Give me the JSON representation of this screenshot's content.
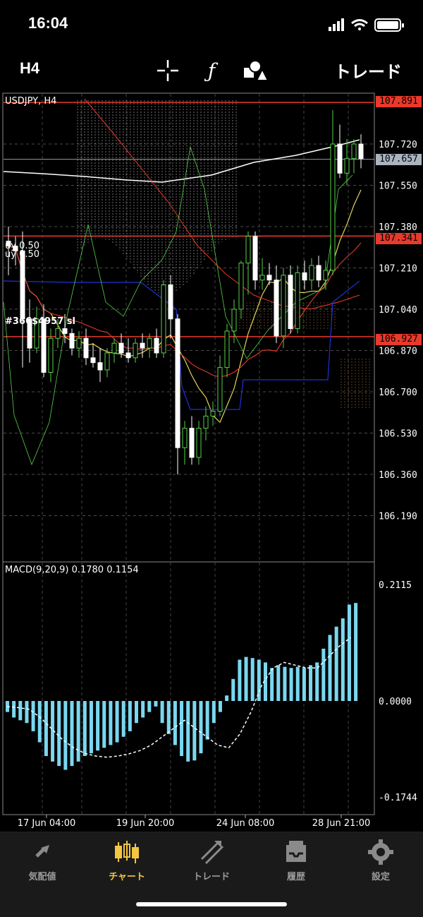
{
  "status": {
    "time": "16:04"
  },
  "toolbar": {
    "timeframe": "H4",
    "trade_label": "トレード",
    "icons": [
      "crosshair-icon",
      "function-icon",
      "objects-icon"
    ]
  },
  "chart": {
    "symbol_label": "USDJPY, H4",
    "price_ticks": [
      "107.720",
      "107.550",
      "107.380",
      "107.210",
      "107.040",
      "106.870",
      "106.700",
      "106.530",
      "106.360",
      "106.190"
    ],
    "badges": [
      {
        "text": "107.891",
        "color": "#e8392b"
      },
      {
        "text": "107.657",
        "color": "#aab4c0"
      },
      {
        "text": "107.341",
        "color": "#e8392b"
      },
      {
        "text": "106.927",
        "color": "#e8392b"
      }
    ],
    "order_labels": [
      "uy 0.50",
      "uy 0.50"
    ],
    "ticket_label": "#366$4957 sl",
    "time_labels": [
      "17 Jun 04:00",
      "19 Jun 20:00",
      "24 Jun 08:00",
      "28 Jun 21:00"
    ],
    "colors": {
      "bull": "#57d14a",
      "bear": "#ffffff",
      "ma_white": "#ffffff",
      "ma_red": "#e8392b",
      "ma_yellow": "#e6d35a",
      "channel_blue": "#2030d8",
      "cloud": "#9a6a3a"
    }
  },
  "macd": {
    "label": "MACD(9,20,9) 0.1780 0.1154",
    "ticks": [
      "0.2115",
      "0.0000",
      "-0.1744"
    ],
    "color": "#7ad7f0"
  },
  "chart_data": [
    {
      "type": "candlestick",
      "title": "USDJPY, H4",
      "ylim": [
        106.05,
        107.95
      ],
      "x": [
        "17 Jun 04:00",
        "19 Jun 20:00",
        "24 Jun 08:00",
        "28 Jun 21:00"
      ],
      "horizontal_lines": [
        107.891,
        107.341,
        106.927
      ],
      "last_price": 107.657,
      "series": [
        {
          "name": "candles",
          "values": [
            [
              107.32,
              107.38,
              107.18,
              107.3
            ],
            [
              107.3,
              107.34,
              107.22,
              107.28
            ],
            [
              107.28,
              107.36,
              106.8,
              107.0
            ],
            [
              107.0,
              107.08,
              106.82,
              106.88
            ],
            [
              106.88,
              107.05,
              106.86,
              107.0
            ],
            [
              107.0,
              107.06,
              106.76,
              106.78
            ],
            [
              106.78,
              106.96,
              106.74,
              106.92
            ],
            [
              106.92,
              107.0,
              106.88,
              106.96
            ],
            [
              106.96,
              107.02,
              106.9,
              106.94
            ],
            [
              106.94,
              106.96,
              106.85,
              106.88
            ],
            [
              106.88,
              106.95,
              106.84,
              106.92
            ],
            [
              106.92,
              106.96,
              106.81,
              106.84
            ],
            [
              106.84,
              106.9,
              106.8,
              106.82
            ],
            [
              106.82,
              106.88,
              106.74,
              106.79
            ],
            [
              106.79,
              106.88,
              106.76,
              106.86
            ],
            [
              106.86,
              106.92,
              106.82,
              106.9
            ],
            [
              106.9,
              106.94,
              106.84,
              106.86
            ],
            [
              106.86,
              106.92,
              106.82,
              106.84
            ],
            [
              106.84,
              106.92,
              106.82,
              106.9
            ],
            [
              106.9,
              106.94,
              106.84,
              106.88
            ],
            [
              106.88,
              106.94,
              106.84,
              106.92
            ],
            [
              106.92,
              106.96,
              106.84,
              106.86
            ],
            [
              106.86,
              107.16,
              106.84,
              107.14
            ],
            [
              107.14,
              107.18,
              106.92,
              107.0
            ],
            [
              107.0,
              107.02,
              106.36,
              106.47
            ],
            [
              106.47,
              106.58,
              106.4,
              106.55
            ],
            [
              106.55,
              106.6,
              106.4,
              106.43
            ],
            [
              106.43,
              106.58,
              106.4,
              106.55
            ],
            [
              106.55,
              106.64,
              106.5,
              106.6
            ],
            [
              106.6,
              106.66,
              106.56,
              106.62
            ],
            [
              106.62,
              106.85,
              106.6,
              106.8
            ],
            [
              106.8,
              106.98,
              106.76,
              106.95
            ],
            [
              106.95,
              107.08,
              106.9,
              107.04
            ],
            [
              107.04,
              107.24,
              107.0,
              107.23
            ],
            [
              107.23,
              107.36,
              107.1,
              107.34
            ],
            [
              107.34,
              107.36,
              107.12,
              107.16
            ],
            [
              107.16,
              107.25,
              107.12,
              107.18
            ],
            [
              107.18,
              107.23,
              107.14,
              107.16
            ],
            [
              107.16,
              107.22,
              106.9,
              106.93
            ],
            [
              106.93,
              107.21,
              106.88,
              107.18
            ],
            [
              107.18,
              107.22,
              106.94,
              106.96
            ],
            [
              106.96,
              107.22,
              106.94,
              107.19
            ],
            [
              107.19,
              107.24,
              107.12,
              107.16
            ],
            [
              107.16,
              107.25,
              107.12,
              107.22
            ],
            [
              107.22,
              107.26,
              107.13,
              107.16
            ],
            [
              107.16,
              107.24,
              107.12,
              107.2
            ],
            [
              107.2,
              107.86,
              107.18,
              107.72
            ],
            [
              107.72,
              107.8,
              107.58,
              107.6
            ],
            [
              107.6,
              107.74,
              107.55,
              107.66
            ],
            [
              107.66,
              107.74,
              107.6,
              107.72
            ],
            [
              107.72,
              107.76,
              107.62,
              107.66
            ]
          ]
        }
      ]
    },
    {
      "type": "bar",
      "title": "MACD(9,20,9) 0.1780 0.1154",
      "ylim": [
        -0.1744,
        0.2115
      ],
      "series": [
        {
          "name": "MACD",
          "values": [
            -0.02,
            -0.03,
            -0.035,
            -0.04,
            -0.055,
            -0.075,
            -0.1,
            -0.11,
            -0.118,
            -0.125,
            -0.118,
            -0.11,
            -0.1,
            -0.095,
            -0.09,
            -0.085,
            -0.08,
            -0.075,
            -0.065,
            -0.055,
            -0.04,
            -0.03,
            -0.02,
            -0.01,
            -0.04,
            -0.06,
            -0.08,
            -0.1,
            -0.11,
            -0.108,
            -0.095,
            -0.07,
            -0.04,
            -0.02,
            0.01,
            0.04,
            0.075,
            0.08,
            0.078,
            0.075,
            0.07,
            0.06,
            0.065,
            0.062,
            0.06,
            0.062,
            0.06,
            0.065,
            0.07,
            0.095,
            0.12,
            0.135,
            0.15,
            0.175,
            0.178
          ]
        },
        {
          "name": "Signal",
          "values": [
            -0.01,
            -0.012,
            -0.015,
            -0.03,
            -0.05,
            -0.07,
            -0.085,
            -0.095,
            -0.1,
            -0.102,
            -0.1,
            -0.096,
            -0.09,
            -0.08,
            -0.065,
            -0.05,
            -0.035,
            -0.05,
            -0.065,
            -0.08,
            -0.085,
            -0.06,
            -0.02,
            0.03,
            0.06,
            0.07,
            0.065,
            0.06,
            0.06,
            0.08,
            0.1,
            0.1154
          ]
        }
      ]
    }
  ],
  "tabs": [
    {
      "label": "気配値",
      "icon": "quotes-icon"
    },
    {
      "label": "チャート",
      "icon": "chart-icon",
      "active": true
    },
    {
      "label": "トレード",
      "icon": "trade-icon"
    },
    {
      "label": "履歴",
      "icon": "history-icon"
    },
    {
      "label": "設定",
      "icon": "settings-icon"
    }
  ]
}
